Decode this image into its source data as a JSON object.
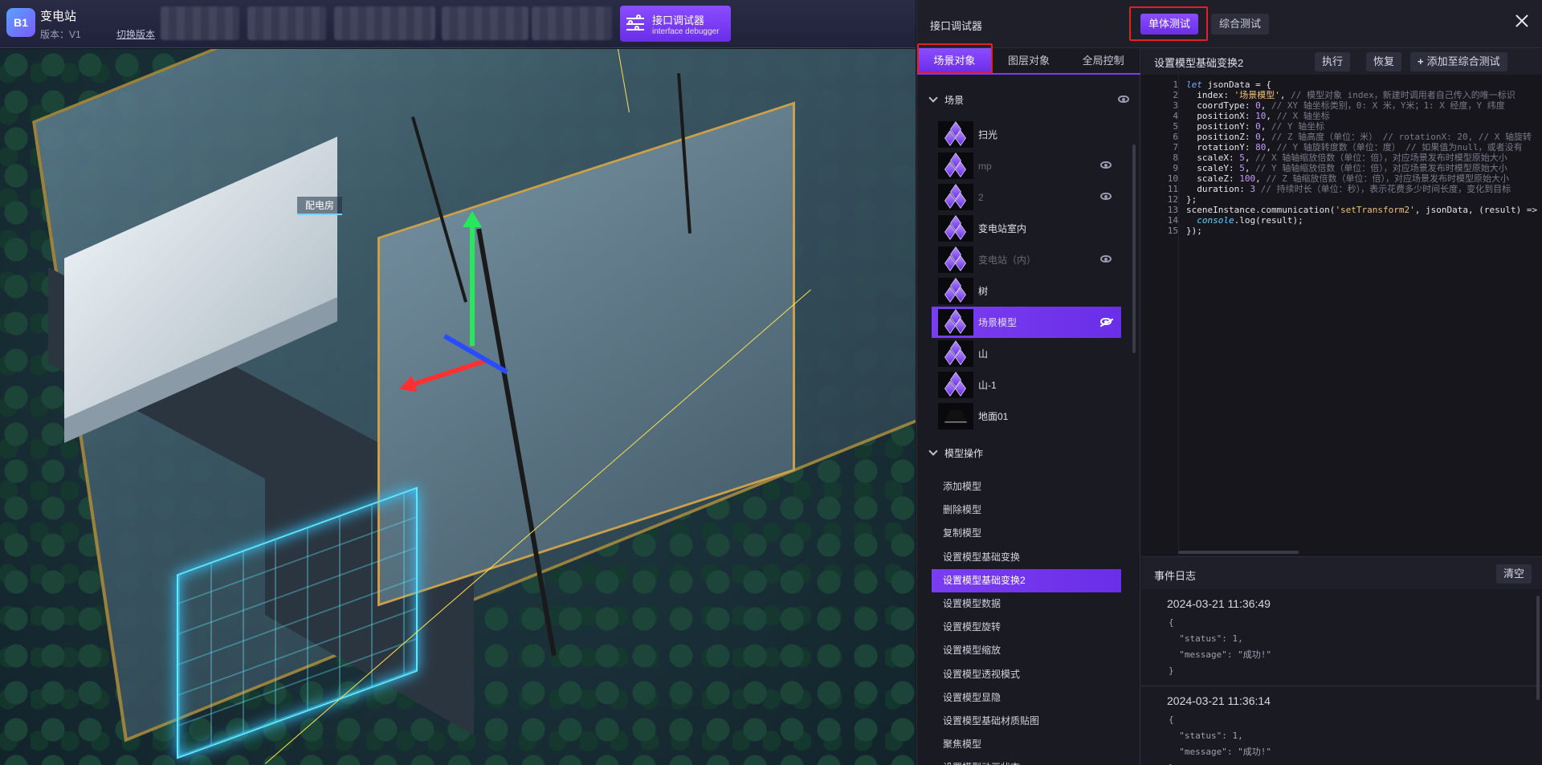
{
  "header": {
    "logo_text": "B1",
    "app_title": "变电站",
    "version": "版本：V1",
    "switch_version": "切换版本",
    "debugger_tab": {
      "title": "接口调试器",
      "subtitle": "interface debugger"
    }
  },
  "scene": {
    "building_label": "配电房"
  },
  "panel": {
    "title": "接口调试器",
    "mode_single": "单体测试",
    "mode_combined": "综合测试",
    "tabs": [
      "场景对象",
      "图层对象",
      "全局控制"
    ],
    "scene_section": "场景",
    "scene_items": [
      {
        "label": "扫光",
        "dim": false,
        "eye": "none"
      },
      {
        "label": "mp",
        "dim": true,
        "eye": "visible"
      },
      {
        "label": "2",
        "dim": true,
        "eye": "visible"
      },
      {
        "label": "变电站室内",
        "dim": false,
        "eye": "none"
      },
      {
        "label": "变电站（内）",
        "dim": true,
        "eye": "visible"
      },
      {
        "label": "树",
        "dim": false,
        "eye": "none"
      },
      {
        "label": "场景模型",
        "dim": false,
        "eye": "hidden",
        "selected": true
      },
      {
        "label": "山",
        "dim": false,
        "eye": "none"
      },
      {
        "label": "山-1",
        "dim": false,
        "eye": "none"
      },
      {
        "label": "地面01",
        "dim": false,
        "eye": "none",
        "thumb": "plane"
      }
    ],
    "ops_section": "模型操作",
    "ops": [
      "添加模型",
      "删除模型",
      "复制模型",
      "设置模型基础变换",
      "设置模型基础变换2",
      "设置模型数据",
      "设置模型旋转",
      "设置模型缩放",
      "设置模型透视模式",
      "设置模型显隐",
      "设置模型基础材质贴图",
      "聚焦模型",
      "设置模型动画状态"
    ],
    "selected_op": 4,
    "code_title": "设置模型基础变换2",
    "btn_execute": "执行",
    "btn_restore": "恢复",
    "btn_add_combined": "添加至综合测试",
    "log_title": "事件日志",
    "btn_clear": "清空",
    "logs": [
      {
        "time": "2024-03-21 11:36:49",
        "body": "{\n  \"status\": 1,\n  \"message\": \"成功!\"\n}"
      },
      {
        "time": "2024-03-21 11:36:14",
        "body": "{\n  \"status\": 1,\n  \"message\": \"成功!\"\n}"
      }
    ]
  }
}
